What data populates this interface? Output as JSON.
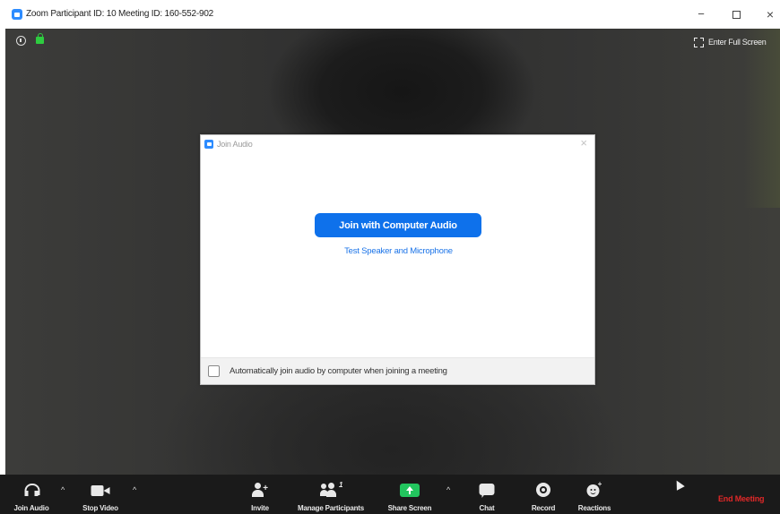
{
  "window": {
    "title": "Zoom Participant ID: 10   Meeting ID: 160-552-902",
    "minimize_label": "−",
    "close_label": "×"
  },
  "video": {
    "fullscreen_label": "Enter Full Screen"
  },
  "dialog": {
    "title": "Join Audio",
    "close_label": "×",
    "join_button_label": "Join with Computer Audio",
    "test_link_label": "Test Speaker and Microphone",
    "auto_join_label": "Automatically join audio by computer when joining a meeting",
    "auto_join_checked": false
  },
  "toolbar": {
    "join_audio": "Join Audio",
    "stop_video": "Stop Video",
    "invite": "Invite",
    "manage_participants": "Manage Participants",
    "participant_count": "1",
    "share_screen": "Share Screen",
    "chat": "Chat",
    "record": "Record",
    "reactions": "Reactions",
    "end_meeting": "End Meeting",
    "caret": "^"
  },
  "colors": {
    "zoom_blue": "#0e71eb",
    "share_green": "#22c55e",
    "end_red": "#e02828",
    "toolbar_bg": "#1a1a1a"
  },
  "icons": {
    "app": "zoom-logo-icon",
    "info": "info-icon",
    "lock": "lock-icon",
    "fullscreen": "fullscreen-icon",
    "headphone": "headphone-icon",
    "camera": "video-camera-icon",
    "invite": "add-person-icon",
    "participants": "participants-icon",
    "share": "share-screen-icon",
    "chat": "chat-bubble-icon",
    "record": "record-icon",
    "reactions": "reactions-icon",
    "cursor": "mouse-cursor-icon"
  }
}
